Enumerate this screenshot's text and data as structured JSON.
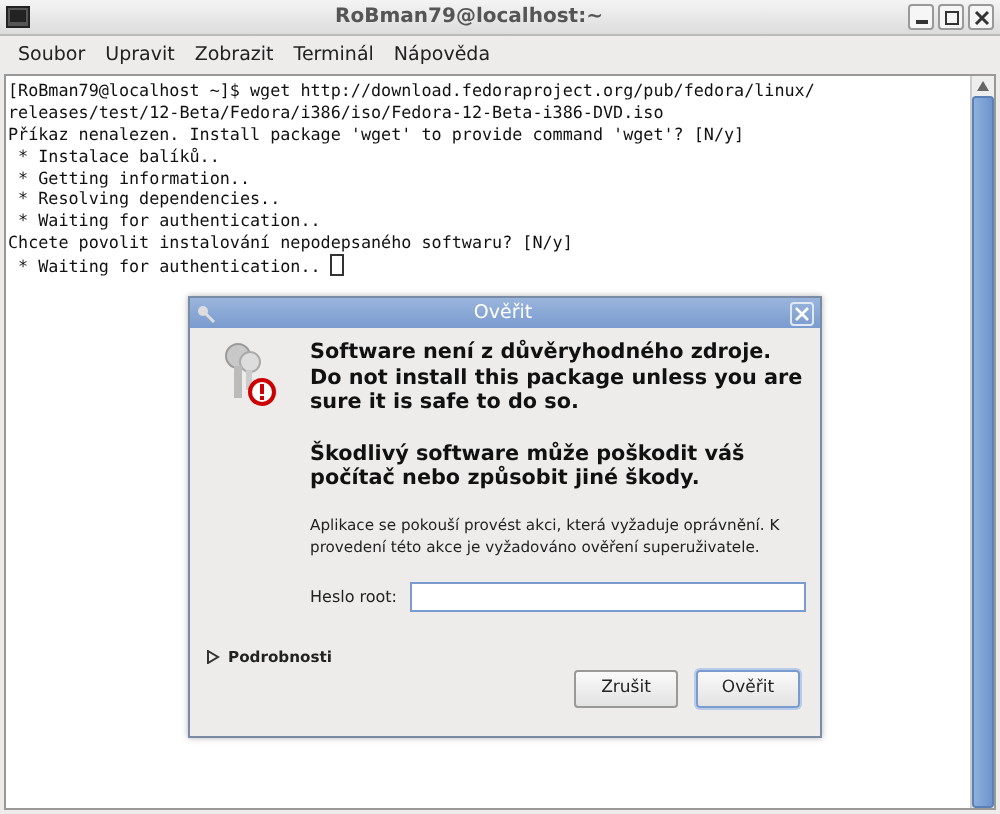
{
  "window": {
    "title": "RoBman79@localhost:~"
  },
  "menu": [
    {
      "label": "Soubor"
    },
    {
      "label": "Upravit"
    },
    {
      "label": "Zobrazit"
    },
    {
      "label": "Terminál"
    },
    {
      "label": "Nápověda"
    }
  ],
  "terminal": {
    "lines": [
      "[RoBman79@localhost ~]$ wget http://download.fedoraproject.org/pub/fedora/linux/",
      "releases/test/12-Beta/Fedora/i386/iso/Fedora-12-Beta-i386-DVD.iso",
      "Příkaz nenalezen. Install package 'wget' to provide command 'wget'? [N/y]",
      " * Instalace balíků..",
      " * Getting information..",
      " * Resolving dependencies..",
      " * Waiting for authentication..",
      "Chcete povolit instalování nepodepsaného softwaru? [N/y]",
      " * Waiting for authentication.. "
    ],
    "cursor": true
  },
  "dialog": {
    "title": "Ověřit",
    "headings": [
      "Software není z důvěryhodného zdroje. Do not install this package unless you are sure it is safe to do so.",
      "Škodlivý software může poškodit váš počítač nebo způsobit jiné škody."
    ],
    "message": "Aplikace se pokouší provést akci, která vyžaduje oprávnění. K provedení této akce je vyžadováno ověření superuživatele.",
    "password": {
      "label": "Heslo root:"
    },
    "details": {
      "label": "Podrobnosti",
      "expanded": false
    },
    "buttons": [
      {
        "label": "Zrušit",
        "default": false
      },
      {
        "label": "Ověřit",
        "default": true
      }
    ]
  }
}
